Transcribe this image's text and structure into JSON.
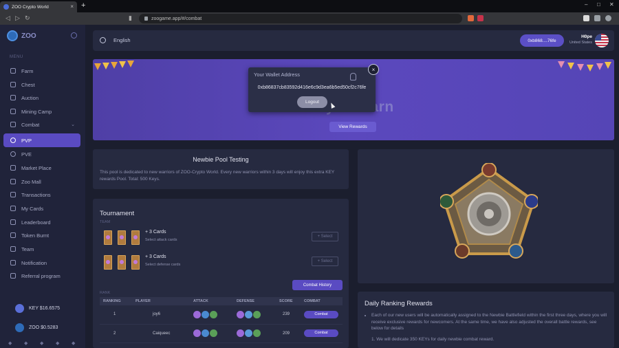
{
  "browser": {
    "tab_title": "ZOO Crypto World",
    "tab_close": "×",
    "new_tab": "+",
    "url": "zoogame.app/#/combat",
    "win_min": "–",
    "win_max": "□",
    "win_close": "✕",
    "back": "◁",
    "forward": "▷",
    "reload": "↻"
  },
  "sidebar": {
    "brand": "ZOO",
    "menu_label": "MENU",
    "items": [
      {
        "label": "Farm"
      },
      {
        "label": "Chest"
      },
      {
        "label": "Auction"
      },
      {
        "label": "Mining Camp"
      },
      {
        "label": "Combat",
        "chevron": "⌄"
      },
      {
        "label": "PVP"
      },
      {
        "label": "PVE"
      },
      {
        "label": "Market Place"
      },
      {
        "label": "Zoo Mall"
      },
      {
        "label": "Transactions"
      },
      {
        "label": "My Cards"
      },
      {
        "label": "Leaderboard"
      },
      {
        "label": "Token Burnt"
      },
      {
        "label": "Team"
      },
      {
        "label": "Notification"
      },
      {
        "label": "Referral program"
      }
    ],
    "balances": [
      {
        "label": "KEY $16.6575",
        "color": "#5a6fd8"
      },
      {
        "label": "ZOO $0.5283",
        "color": "#2e6bb8"
      }
    ]
  },
  "header": {
    "language": "English",
    "wallet_short": "0xb868....76fe",
    "user_name": "H0pe",
    "user_country": "United States"
  },
  "banner": {
    "title": "Play To Earn",
    "view_rewards": "View Rewards"
  },
  "wallet_popup": {
    "title": "Your Wallet Address",
    "address": "0xb86837cb83592d416e6c9d3ea6b5ed50cf2c76fe",
    "logout": "Logout",
    "close": "×"
  },
  "pool": {
    "title": "Newbie Pool Testing",
    "description": "This pool is dedicated to new warriors of ZOO-Crypto World. Every new warriors within 3 days will enjoy this extra KEY rewards Pool. Total: 500 Keys."
  },
  "tournament": {
    "title": "Tournament",
    "team_label": "TEAM",
    "attack": {
      "plus": "+ 3 Cards",
      "sub": "Select attack cards",
      "button": "+ Select"
    },
    "defense": {
      "plus": "+ 3 Cards",
      "sub": "Select defense cards",
      "button": "+ Select"
    },
    "combat_history": "Combat History",
    "rank_label": "RANK",
    "columns": [
      "RANKING",
      "PLAYER",
      "ATTACK",
      "DEFENSE",
      "SCORE",
      "COMBAT"
    ],
    "rows": [
      {
        "ranking": "1",
        "player": "joy6",
        "score": "239",
        "combat": "Combat"
      },
      {
        "ranking": "2",
        "player": "Caiqueec",
        "score": "209",
        "combat": "Combat"
      }
    ]
  },
  "daily": {
    "title": "Daily Ranking Rewards",
    "bullet": "Each of our new users will be automatically assigned to the Newbie Battlefield within the first three days, where you will receive exclusive rewards for newcomers. At the same time, we have also adjusted the overall battle rewards, see below for details",
    "numbered": "1. We will dedicate 350 KEYs for daily newbie combat reward."
  },
  "colors": {
    "accent": "#5a4bc2",
    "sidebar_bg": "#20233a",
    "card_bg": "#262a40"
  }
}
